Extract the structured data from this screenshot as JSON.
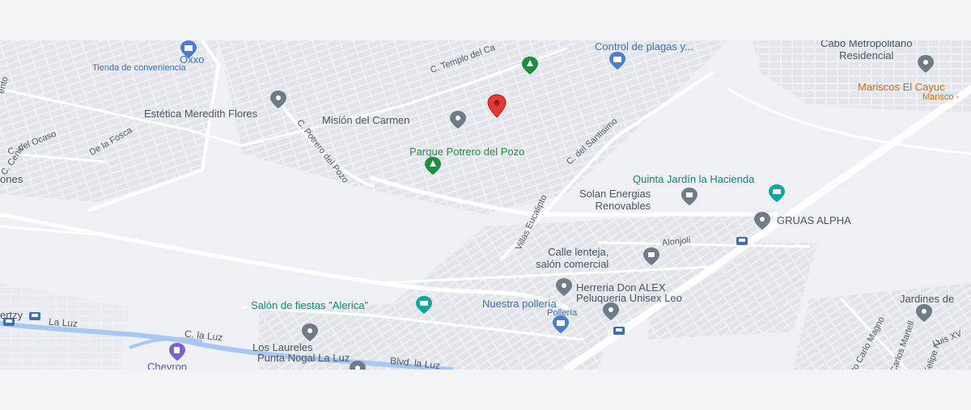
{
  "poi": {
    "oxxo": "Oxxo",
    "oxxo_sub": "Tienda de conveniencia",
    "control_plagas": "Control de plagas y...",
    "cabo": "Cabo Metropolitano\nResidencial",
    "mariscos": "Mariscos El Cayuc",
    "mariscos_sub": "Marisco -",
    "estetica": "Estética Meredith Flores",
    "mision": "Misión del Carmen",
    "parque": "Parque Potrero del Pozo",
    "quinta": "Quinta Jardín la Hacienda",
    "solan": "Solan Energias\nRenovables",
    "gruas": "GRUAS ALPHA",
    "calle_lenteja": "Calle lenteja,\nsalón comercial",
    "herreria": "Herreria Don ALEX",
    "peluqueria": "Peluqueria Unisex Leo",
    "salon_fiestas": "Salón de fiestas \"Alerica\"",
    "nuestra_polleria": "Nuestra pollería",
    "nuestra_polleria_sub": "Pollería",
    "jardines": "Jardines de",
    "los_laureles": "Los Laureles",
    "punta_nogal": "Punta Nogal La Luz",
    "chevron": "Chevron",
    "ones": "ones",
    "ertzy": "ertzy"
  },
  "streets": {
    "templo": "C. Templo del Ca",
    "ocaso": "C. del Ocaso",
    "cenit": "C. Cenit",
    "la_fosca": "De la Fosca",
    "potrero": "C. Potrero del Pozo",
    "santisimo": "C. del Santisimo",
    "villas_eucalipto": "Villas Eucalipto",
    "alonjoli": "Alonjoli",
    "la_luz": "La Luz",
    "c_la_luz": "C. la Luz",
    "blvd_la_luz": "Blvd. la Luz",
    "carlo_magno": "Cto Carlo Magno",
    "martell": "Carlos Martell",
    "luis_xv": "Luis XV",
    "felipe": "Felipe IV",
    "ento": "ento"
  },
  "colors": {
    "selected_pin": "#e53935",
    "poi_pin": "#6f7c87",
    "park_pin": "#1e8e3e",
    "venue_pin": "#12a3a3",
    "shop_pin": "#4a7fd0",
    "water": "#a9c7f5"
  },
  "icons": {
    "selected": "map-pin-icon",
    "park": "tree-icon",
    "venue": "event-venue-icon",
    "shop": "shopping-bag-icon",
    "gas": "gas-station-icon",
    "bus": "bus-stop-icon"
  }
}
